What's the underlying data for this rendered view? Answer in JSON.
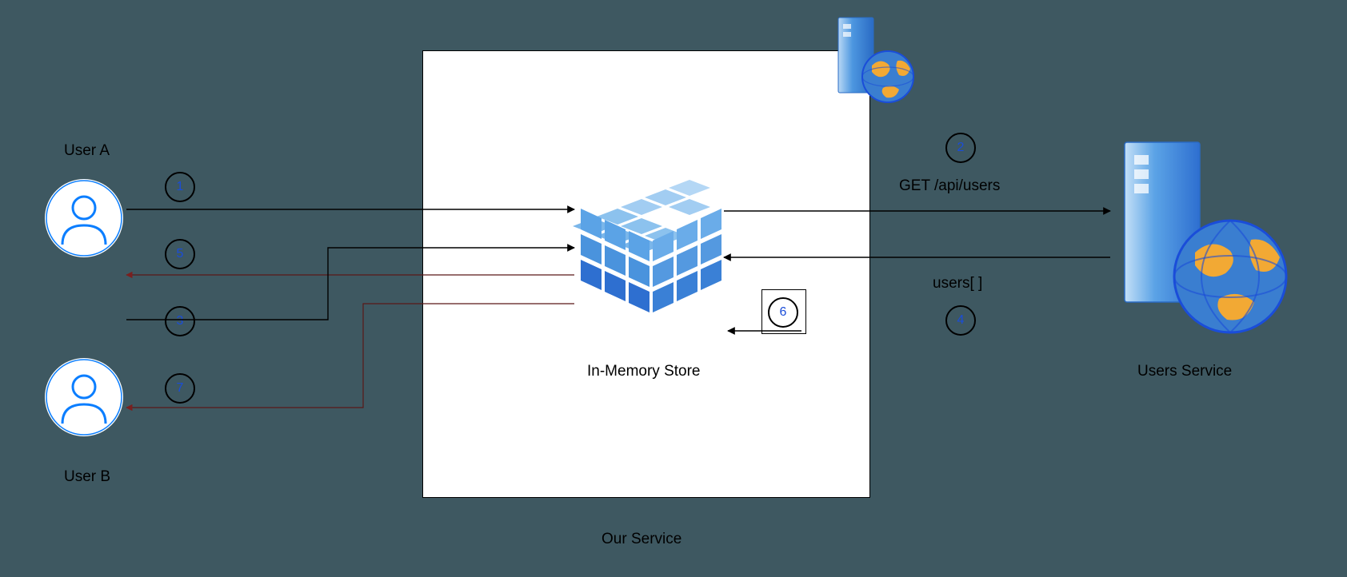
{
  "users": {
    "a_label": "User A",
    "b_label": "User B"
  },
  "service": {
    "our_label": "Our Service",
    "store_label": "In-Memory Store",
    "users_svc_label": "Users Service"
  },
  "api": {
    "request": "GET /api/users",
    "response": "users[ ]"
  },
  "steps": {
    "s1": "1",
    "s2": "2",
    "s3": "3",
    "s4": "4",
    "s5": "5",
    "s6": "6",
    "s7": "7"
  },
  "colors": {
    "bg": "#3e5861",
    "user_outline": "#0b7eff",
    "step_number": "#1a4dd9",
    "cube_light": "#a2cdf2",
    "cube_mid": "#5ba3e6",
    "cube_dark": "#2e6fd0"
  }
}
